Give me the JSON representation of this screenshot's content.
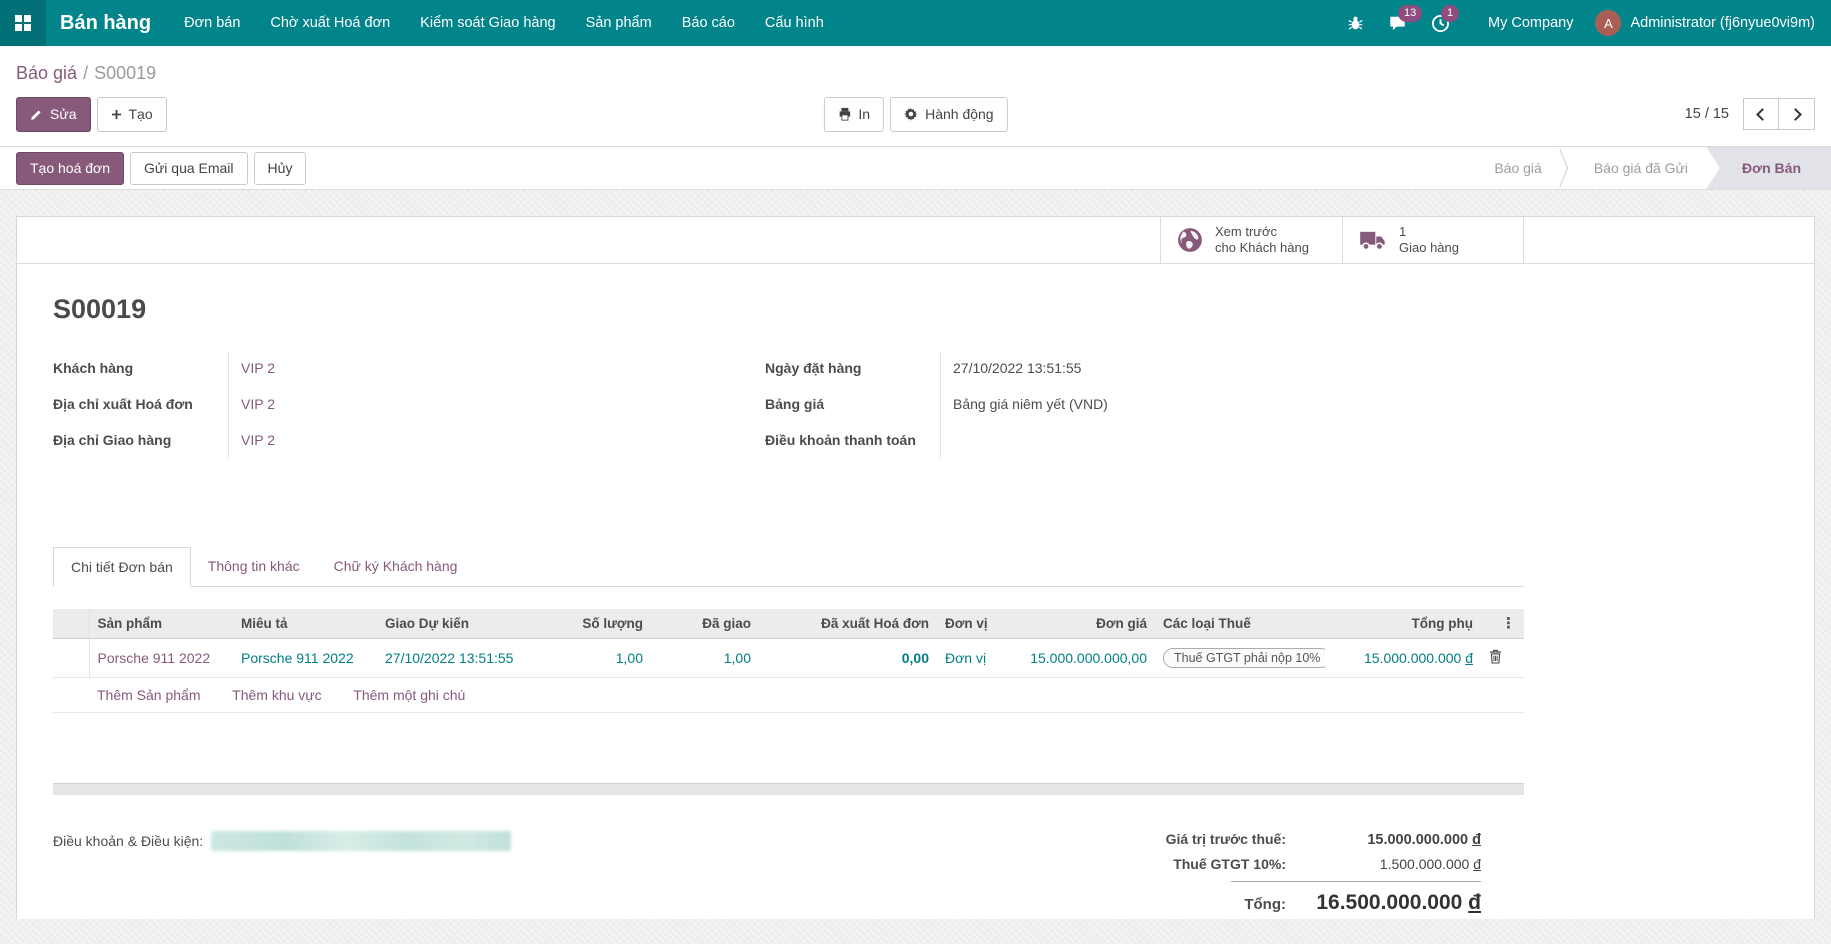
{
  "navbar": {
    "brand": "Bán hàng",
    "menus": [
      "Đơn bán",
      "Chờ xuất Hoá đơn",
      "Kiểm soát Giao hàng",
      "Sản phẩm",
      "Báo cáo",
      "Cấu hình"
    ],
    "messages_badge": "13",
    "activities_badge": "1",
    "company": "My Company",
    "avatar_letter": "A",
    "user": "Administrator (fj6nyue0vi9m)"
  },
  "control_panel": {
    "breadcrumb_parent": "Báo giá",
    "breadcrumb_sep": "/",
    "breadcrumb_current": "S00019",
    "edit_label": "Sửa",
    "create_label": "Tạo",
    "print_label": "In",
    "action_label": "Hành động",
    "pager_value": "15 / 15"
  },
  "statusbar": {
    "create_invoice_label": "Tạo hoá đơn",
    "send_email_label": "Gửi qua Email",
    "cancel_label": "Hủy",
    "steps": [
      "Báo giá",
      "Báo giá đã Gửi",
      "Đơn Bán"
    ]
  },
  "smart_buttons": {
    "preview": {
      "line1": "Xem trước",
      "line2": "cho Khách hàng"
    },
    "delivery": {
      "line1": "1",
      "line2": "Giao hàng"
    }
  },
  "record": {
    "title": "S00019",
    "fields_left": [
      {
        "label": "Khách hàng",
        "value": "VIP 2"
      },
      {
        "label": "Địa chỉ xuất Hoá đơn",
        "value": "VIP 2"
      },
      {
        "label": "Địa chỉ Giao hàng",
        "value": "VIP 2"
      }
    ],
    "fields_right": [
      {
        "label": "Ngày đặt hàng",
        "value": "27/10/2022 13:51:55"
      },
      {
        "label": "Bảng giá",
        "value": "Bảng giá niêm yết (VND)"
      },
      {
        "label": "Điều khoản thanh toán",
        "value": ""
      }
    ]
  },
  "tabs": [
    "Chi tiết Đơn bán",
    "Thông tin khác",
    "Chữ ký Khách hàng"
  ],
  "order_lines": {
    "columns": [
      "Sản phẩm",
      "Miêu tả",
      "Giao Dự kiến",
      "Số lượng",
      "Đã giao",
      "Đã xuất Hoá đơn",
      "Đơn vị",
      "Đơn giá",
      "Các loại Thuế",
      "Tổng phụ"
    ],
    "rows": [
      {
        "product": "Porsche 911 2022",
        "description": "Porsche 911 2022",
        "delivery_date": "27/10/2022 13:51:55",
        "quantity": "1,00",
        "delivered": "1,00",
        "invoiced": "0,00",
        "uom": "Đơn vị",
        "unit_price": "15.000.000.000,00",
        "taxes": "Thuế GTGT phải nộp 10%",
        "subtotal": "15.000.000.000",
        "currency": "đ"
      }
    ],
    "add_product_label": "Thêm Sản phẩm",
    "add_section_label": "Thêm khu vực",
    "add_note_label": "Thêm một ghi chú"
  },
  "footer": {
    "terms_label": "Điều khoản & Điều kiện:",
    "untaxed_label": "Giá trị trước thuế:",
    "untaxed_amount": "15.000.000.000",
    "tax_label": "Thuế GTGT 10%:",
    "tax_amount": "1.500.000.000",
    "total_label": "Tổng:",
    "total_amount": "16.500.000.000",
    "currency": "đ"
  },
  "colors": {
    "navbar_teal": "#02848b",
    "primary_purple": "#875a7b",
    "badge_magenta": "#8d4d7f",
    "avatar_brown": "#ab5f54",
    "cell_teal": "#017e84",
    "active_step_bg": "#e2e3e9"
  }
}
